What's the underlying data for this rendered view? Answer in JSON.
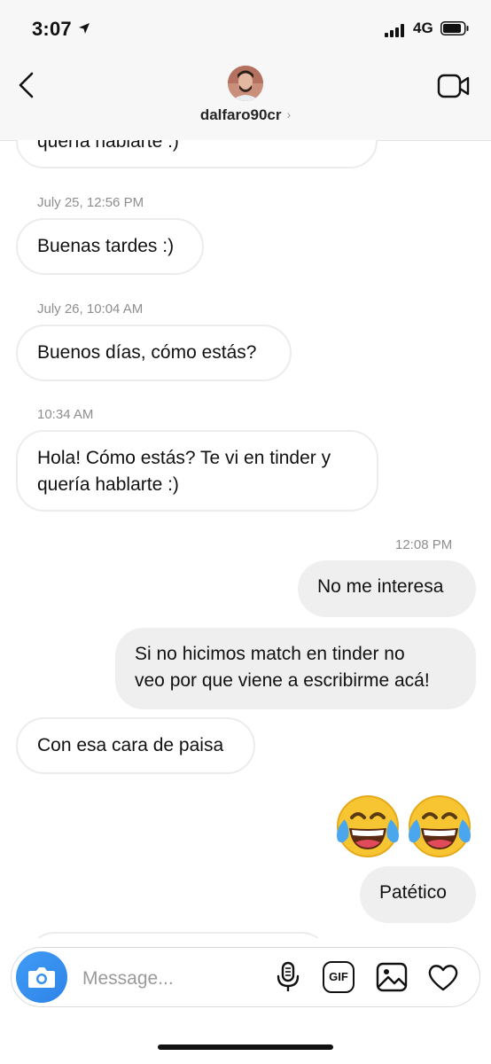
{
  "status_bar": {
    "time": "3:07",
    "network": "4G"
  },
  "header": {
    "username": "dalfaro90cr"
  },
  "messages": {
    "m0": {
      "text": "quería hablarte :)"
    },
    "ts1": "July 25, 12:56 PM",
    "m1": {
      "text": "Buenas tardes :)"
    },
    "ts2": "July 26, 10:04 AM",
    "m2": {
      "text": "Buenos días, cómo estás?"
    },
    "ts3": "10:34 AM",
    "m3": {
      "line1": "Hola! Cómo estás? Te vi en tinder y",
      "line2": "quería hablarte :)"
    },
    "ts4": "12:08 PM",
    "m4": {
      "text": "No me interesa"
    },
    "m5": {
      "line1": "Si no hicimos match en tinder no",
      "line2": "veo por que viene a escribirme acá!"
    },
    "m6": {
      "text": "Con esa cara de paisa"
    },
    "m7": {
      "emoji": "face-with-tears-of-joy"
    },
    "m8": {
      "text": "Patético"
    }
  },
  "composer": {
    "placeholder": "Message...",
    "gif_label": "GIF",
    "icons": [
      "camera-icon",
      "microphone-icon",
      "gif-icon",
      "image-icon",
      "heart-icon"
    ]
  },
  "colors": {
    "accent_blue": "#3897f0",
    "sent_bubble": "#efefef",
    "received_border": "#ececec",
    "timestamp": "#8e8e8e"
  }
}
